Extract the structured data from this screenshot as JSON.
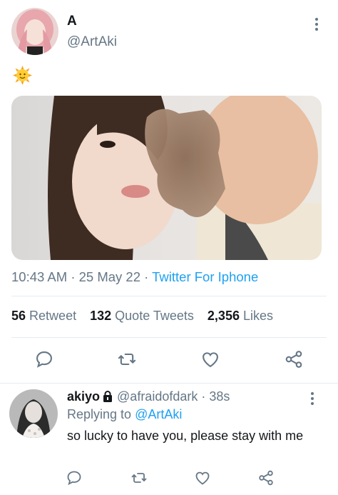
{
  "tweet": {
    "author_name": "A",
    "author_handle": "@ArtAki",
    "text_emoji": "🌞",
    "time": "10:43 AM",
    "date": "25 May 22",
    "source": "Twitter For Iphone",
    "stats": {
      "retweets_count": "56",
      "retweets_label": "Retweet",
      "quotes_count": "132",
      "quotes_label": "Quote Tweets",
      "likes_count": "2,356",
      "likes_label": "Likes"
    }
  },
  "reply": {
    "author_name": "akiyo",
    "author_handle": "@afraidofdark",
    "time_ago": "38s",
    "replying_to_label": "Replying to",
    "replying_to_handle": "@ArtAki",
    "text": "so lucky to have you, please stay with me"
  },
  "icons": {
    "reply": "comment-icon",
    "retweet": "retweet-icon",
    "like": "heart-icon",
    "share": "share-icon",
    "more": "kebab-menu-icon",
    "protected": "lock-icon"
  },
  "colors": {
    "accent": "#1da1f2",
    "secondary_text": "#657786",
    "icon": "#657786"
  }
}
